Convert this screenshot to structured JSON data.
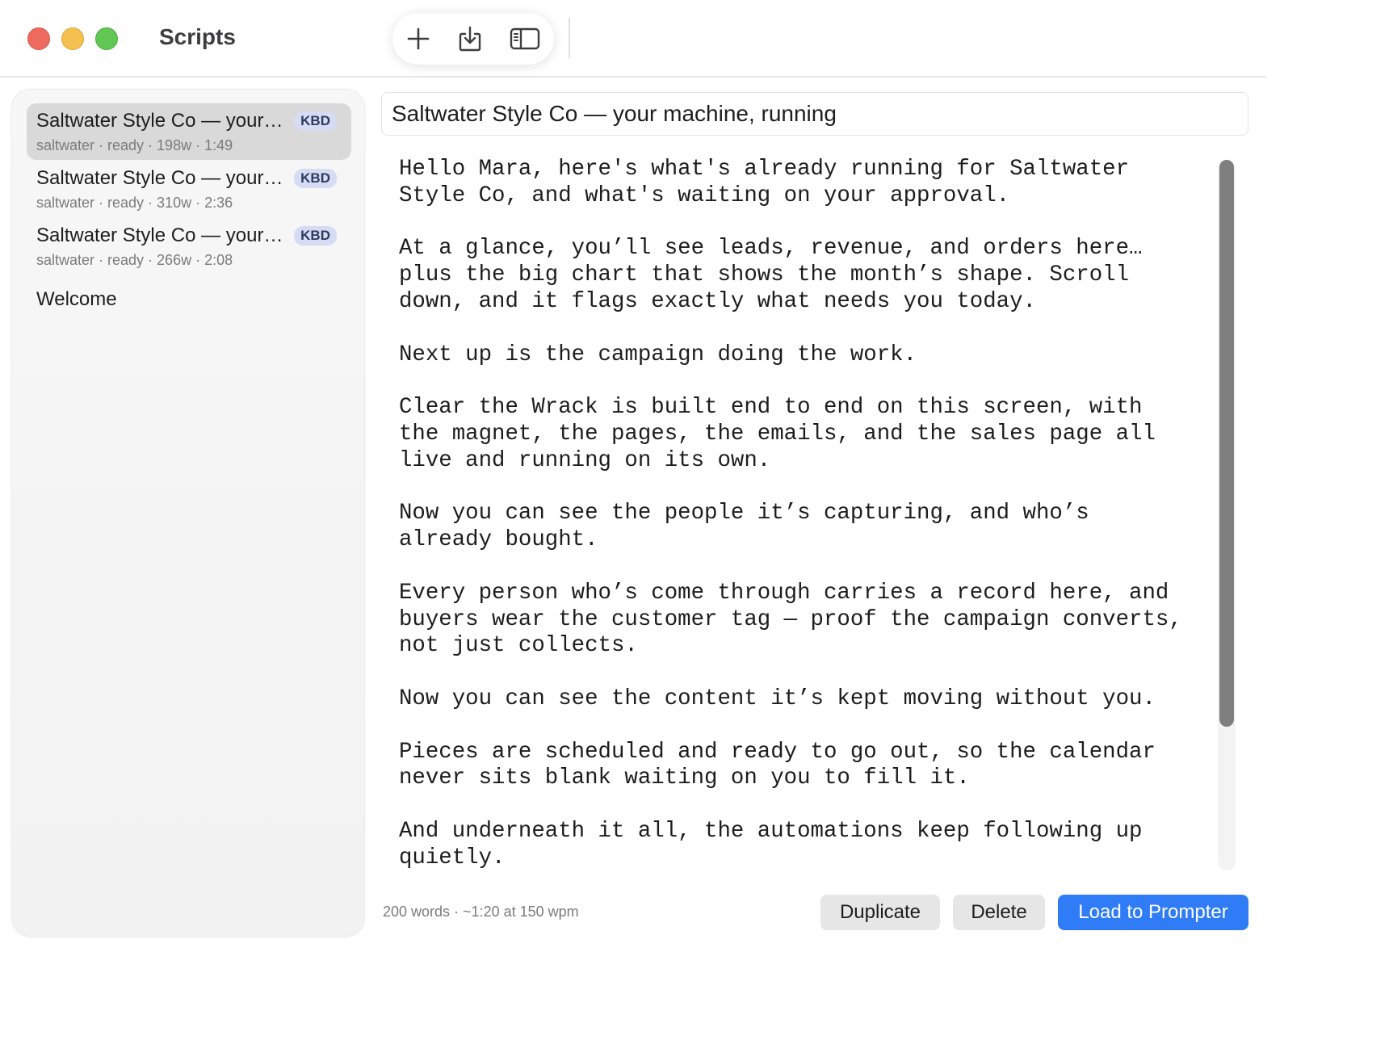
{
  "window": {
    "title": "Scripts"
  },
  "toolbar": {
    "icons": [
      "plus-icon",
      "import-icon",
      "sidebar-toggle-icon"
    ]
  },
  "sidebar": {
    "items": [
      {
        "title": "Saltwater Style Co — your…",
        "meta": "saltwater · ready · 198w · 1:49",
        "badge": "KBD",
        "selected": true
      },
      {
        "title": "Saltwater Style Co — your…",
        "meta": "saltwater · ready · 310w · 2:36",
        "badge": "KBD",
        "selected": false
      },
      {
        "title": "Saltwater Style Co — your…",
        "meta": "saltwater · ready · 266w · 2:08",
        "badge": "KBD",
        "selected": false
      }
    ],
    "plain_item": "Welcome"
  },
  "editor": {
    "title_value": "Saltwater Style Co — your machine, running",
    "paragraphs": [
      "Hello Mara, here's what's already running for Saltwater\nStyle Co, and what's waiting on your approval.",
      "At a glance, you’ll see leads, revenue, and orders here…\nplus the big chart that shows the month’s shape. Scroll\ndown, and it flags exactly what needs you today.",
      "Next up is the campaign doing the work.",
      "Clear the Wrack is built end to end on this screen, with\nthe magnet, the pages, the emails, and the sales page all\nlive and running on its own.",
      "Now you can see the people it’s capturing, and who’s\nalready bought.",
      "Every person who’s come through carries a record here, and\nbuyers wear the customer tag — proof the campaign converts,\nnot just collects.",
      "Now you can see the content it’s kept moving without you.",
      "Pieces are scheduled and ready to go out, so the calendar\nnever sits blank waiting on you to fill it.",
      "And underneath it all, the automations keep following up\nquietly."
    ]
  },
  "footer": {
    "status": "200 words · ~1:20 at 150 wpm",
    "duplicate_label": "Duplicate",
    "delete_label": "Delete",
    "load_label": "Load to Prompter"
  },
  "colors": {
    "accent": "#2f7cf6",
    "selected_row": "#d9d9d9",
    "badge_bg": "#d5dcf4"
  }
}
